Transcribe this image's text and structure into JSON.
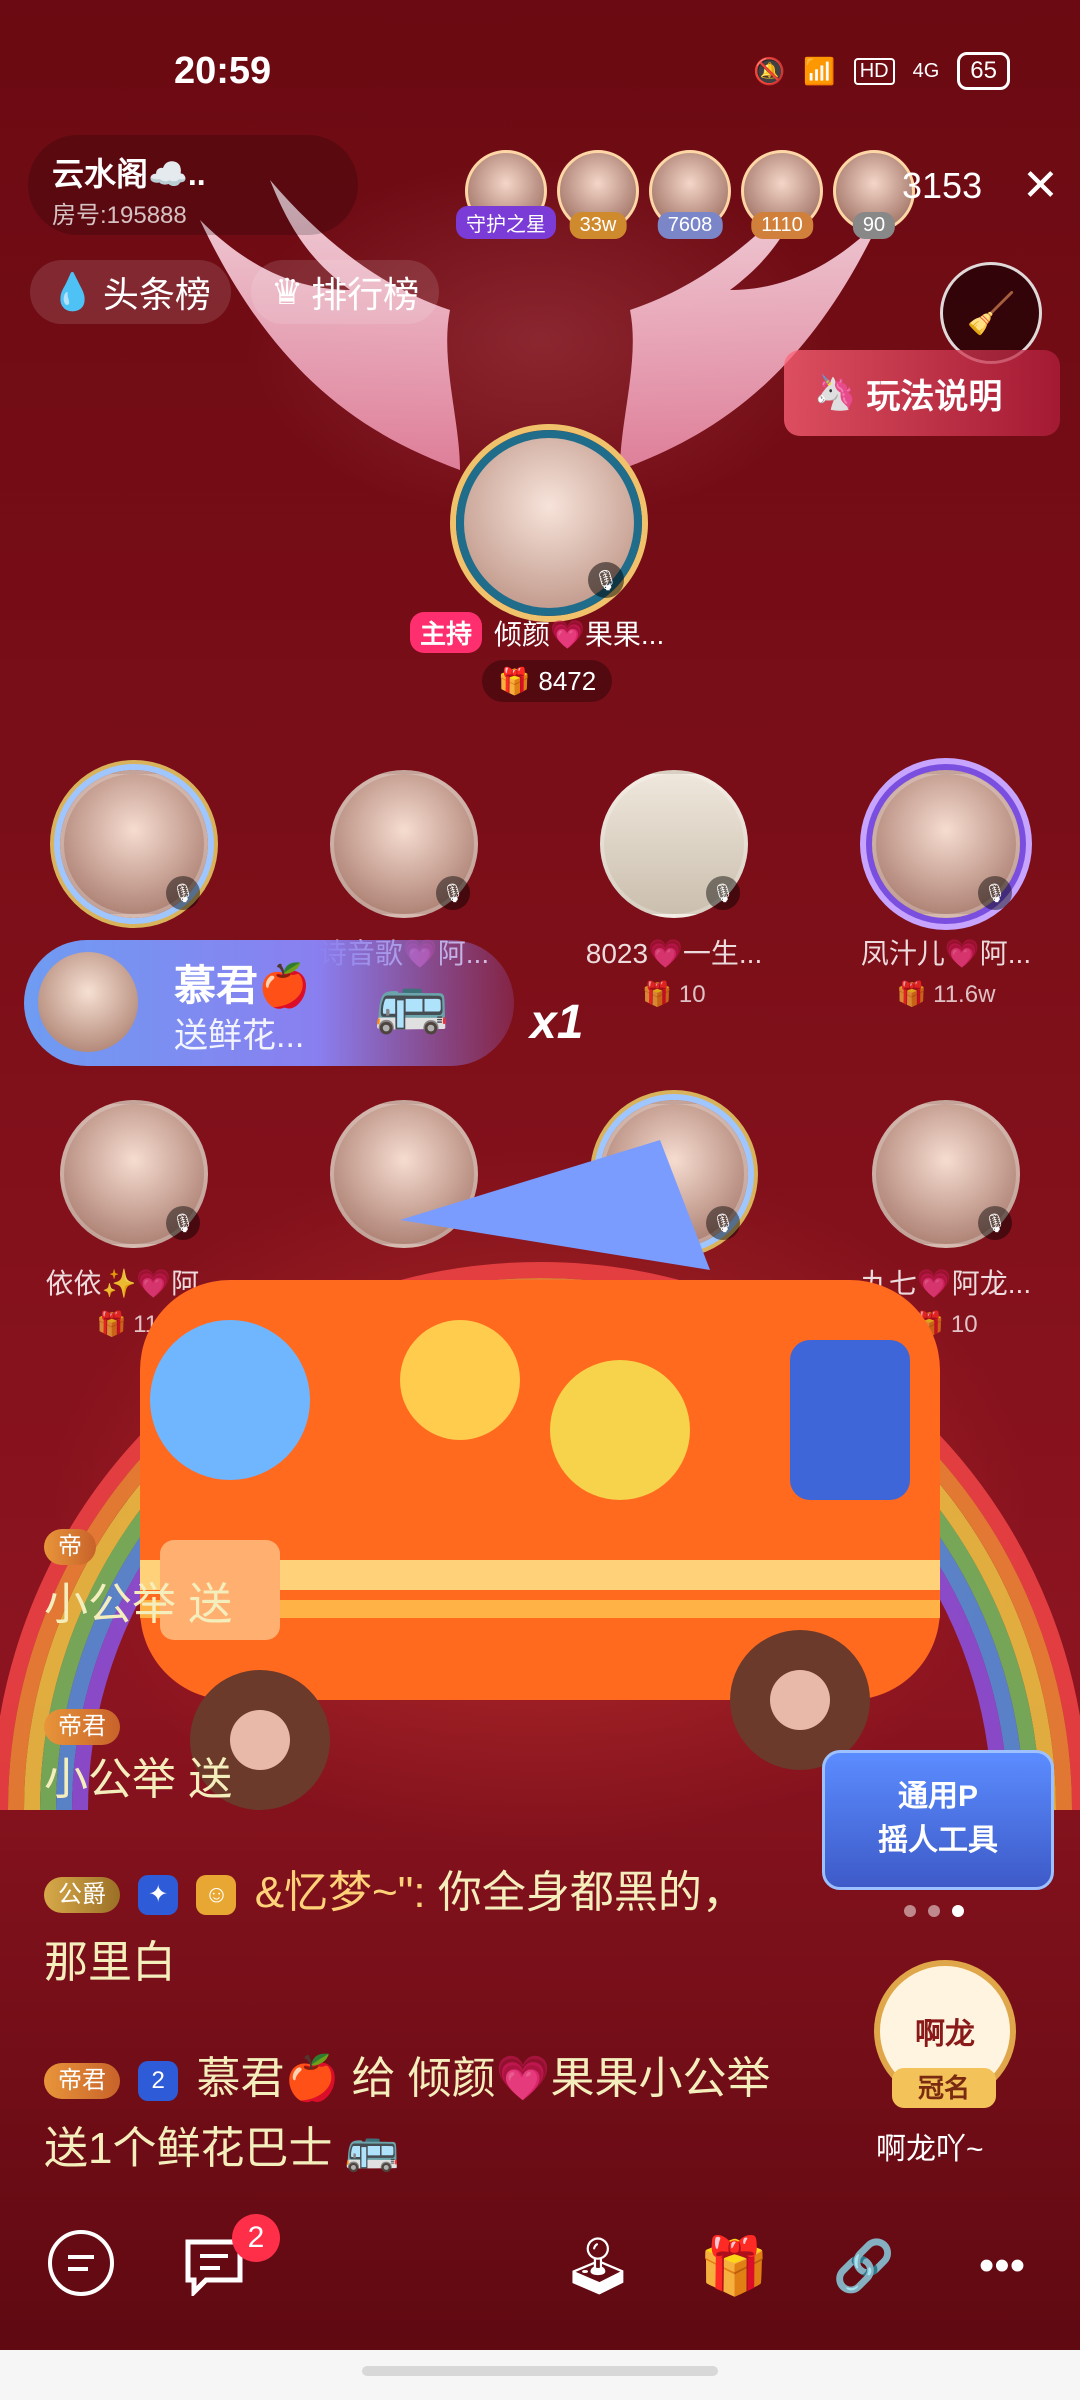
{
  "status_bar": {
    "time": "20:59",
    "battery": "65",
    "network": "4G",
    "hd": "HD"
  },
  "room": {
    "name": "云水阁☁️..",
    "room_id": "房号:195888"
  },
  "tabs": {
    "headlines": "头条榜",
    "ranking": "排行榜"
  },
  "viewers": {
    "avatars": [
      {
        "tag": "守护之星"
      },
      {
        "tag": "33w"
      },
      {
        "tag": "7608"
      },
      {
        "tag": "1110"
      },
      {
        "tag": "90"
      }
    ],
    "count": "3153"
  },
  "howto_label": "玩法说明",
  "host": {
    "badge": "主持",
    "name": "倾颜💗果果...",
    "score": "8472"
  },
  "seats": [
    {
      "name": "",
      "score": ""
    },
    {
      "name": "诗音歌💗阿...",
      "score": ""
    },
    {
      "name": "8023💗一生...",
      "score": "10"
    },
    {
      "name": "凤汁儿💗阿...",
      "score": "11.6w"
    },
    {
      "name": "依依✨💗阿...",
      "score": "114"
    },
    {
      "name": "",
      "score": ""
    },
    {
      "name": "",
      "score": ""
    },
    {
      "name": "九七💗阿龙...",
      "score": "10"
    }
  ],
  "gift_banner": {
    "sender": "慕君🍎",
    "action": "送鲜花...",
    "multiplier": "x1"
  },
  "chat": {
    "msg1_prefix": "小公举 送",
    "msg2_prefix": "小公举 送",
    "msg3": {
      "level": "公爵",
      "user": "&忆梦~\":",
      "text": "你全身都黑的，那里白"
    },
    "msg4": {
      "level": "帝君",
      "rank": "2",
      "text": "慕君🍎 给 倾颜💗果果小公举 送1个鲜花巴士"
    }
  },
  "side_banner": {
    "text": "通用P\n摇人工具"
  },
  "crown": {
    "glyph": "啊龙",
    "label": "冠名",
    "name": "啊龙吖~"
  },
  "bottom": {
    "badge_count": "2"
  },
  "colors": {
    "accent_pink": "#ff2e6e",
    "bg_red": "#7a0f17",
    "chat_text": "#f4eebd"
  }
}
